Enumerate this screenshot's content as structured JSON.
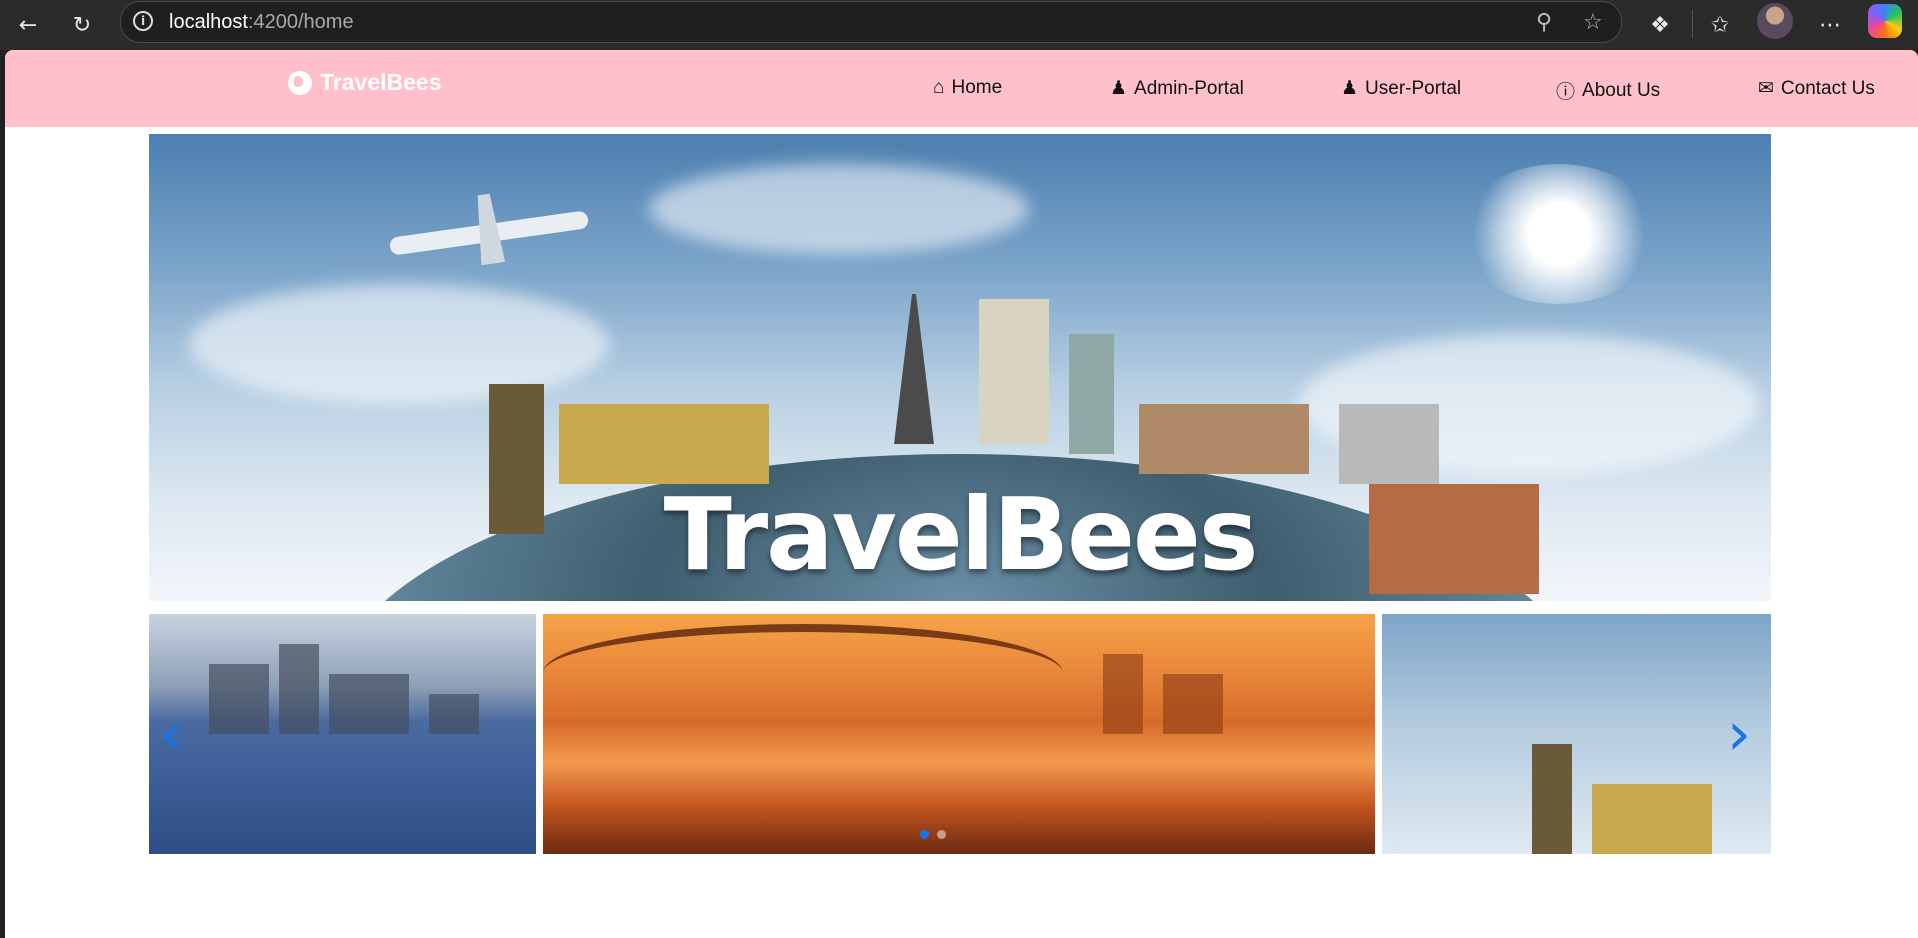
{
  "browser": {
    "url_host": "localhost",
    "url_path": ":4200/home"
  },
  "navbar": {
    "brand": "TravelBees",
    "links": [
      {
        "label": "Home",
        "icon": "home-icon"
      },
      {
        "label": "Admin-Portal",
        "icon": "admin-user-icon"
      },
      {
        "label": "User-Portal",
        "icon": "user-icon"
      },
      {
        "label": "About Us",
        "icon": "info-icon"
      },
      {
        "label": "Contact Us",
        "icon": "envelope-icon"
      }
    ],
    "background": "#ffc0cb"
  },
  "hero": {
    "title": "TravelBees"
  },
  "carousel": {
    "prev_icon": "chevron-left-icon",
    "next_icon": "chevron-right-icon",
    "indicator_count": 2,
    "active_index": 0,
    "accent": "#1a73e8"
  }
}
